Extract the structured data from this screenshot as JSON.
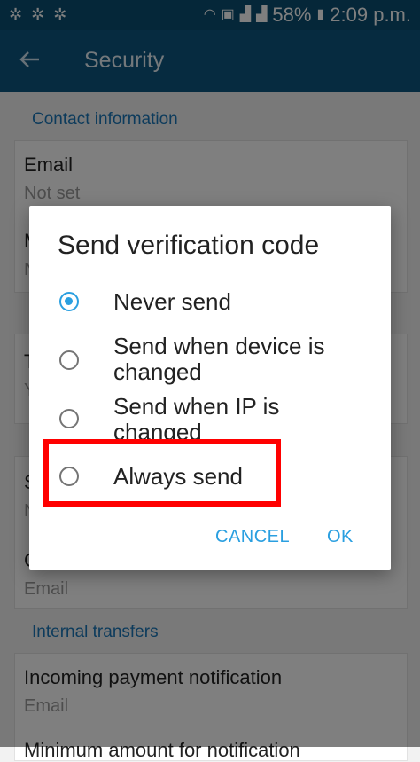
{
  "status_bar": {
    "battery_percent": "58%",
    "time": "2:09 p.m."
  },
  "app_bar": {
    "title": "Security"
  },
  "background": {
    "contact_section_header": "Contact information",
    "email_title": "Email",
    "email_value": "Not set",
    "row2_initial": "M",
    "row2_sub_initial": "N",
    "row3_initial": "T",
    "row3_sub_initial": "Y",
    "row4_initial": "S",
    "row4_sub_initial": "N",
    "row5_initial": "C",
    "row5_sub": "Email",
    "internal_section_header": "Internal transfers",
    "incoming_title": "Incoming payment notification",
    "incoming_value": "Email",
    "min_amount_cut": "Minimum amount for notification"
  },
  "dialog": {
    "title": "Send verification code",
    "options": [
      {
        "label": "Never send",
        "selected": true
      },
      {
        "label": "Send when device is changed",
        "selected": false
      },
      {
        "label": "Send when IP is changed",
        "selected": false
      },
      {
        "label": "Always send",
        "selected": false
      }
    ],
    "cancel_label": "CANCEL",
    "ok_label": "OK",
    "accent_color": "#2a9fe0",
    "highlight_color": "#ff0000"
  }
}
